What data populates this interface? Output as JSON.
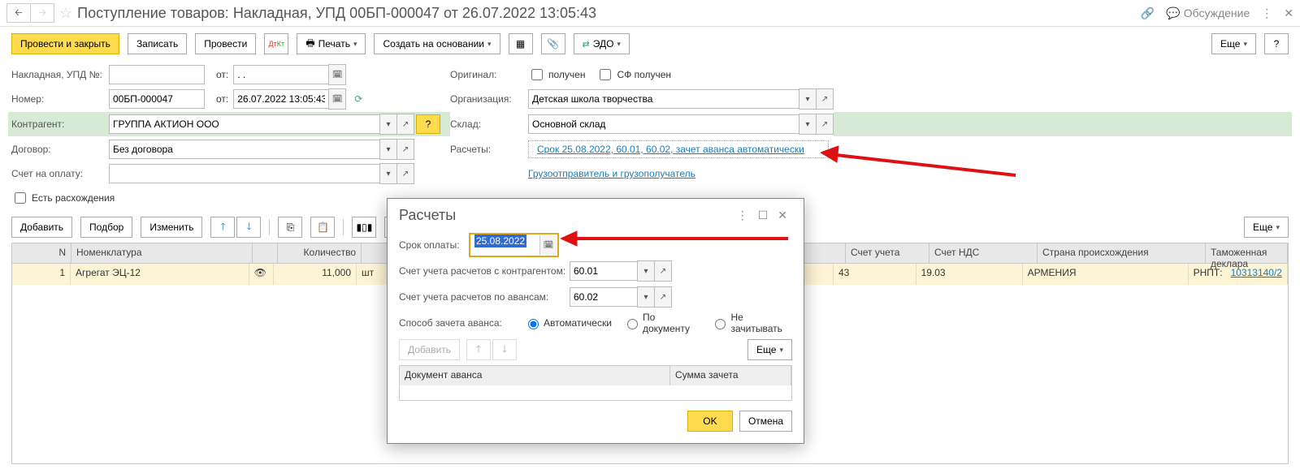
{
  "header": {
    "title": "Поступление товаров: Накладная, УПД 00БП-000047 от 26.07.2022 13:05:43",
    "discuss": "Обсуждение"
  },
  "cmd": {
    "post_close": "Провести и закрыть",
    "write": "Записать",
    "post": "Провести",
    "print": "Печать",
    "create_based": "Создать на основании",
    "edo": "ЭДО",
    "more": "Еще"
  },
  "form": {
    "invoice_label": "Накладная, УПД №:",
    "from": "от:",
    "date1": ". .",
    "number_label": "Номер:",
    "number": "00БП-000047",
    "date2": "26.07.2022 13:05:43",
    "contragent_label": "Контрагент:",
    "contragent": "ГРУППА АКТИОН ООО",
    "contract_label": "Договор:",
    "contract": "Без договора",
    "bill_label": "Счет на оплату:",
    "diff": "Есть расхождения",
    "original_label": "Оригинал:",
    "received": "получен",
    "sf_received": "СФ получен",
    "org_label": "Организация:",
    "org": "Детская школа творчества",
    "warehouse_label": "Склад:",
    "warehouse": "Основной склад",
    "settle_label": "Расчеты:",
    "settle_link": "Срок 25.08.2022, 60.01, 60.02, зачет аванса автоматически",
    "consignor": "Грузоотправитель и грузополучатель"
  },
  "grid_toolbar": {
    "add": "Добавить",
    "pick": "Подбор",
    "edit": "Изменить",
    "more": "Еще"
  },
  "grid": {
    "cols": {
      "n": "N",
      "name": "Номенклатура",
      "qty": "Количество",
      "acct": "Счет учета",
      "vat": "Счет НДС",
      "country": "Страна происхождения",
      "decl": "Таможенная деклара"
    },
    "row": {
      "n": "1",
      "name": "Агрегат ЭЦ-12",
      "qty": "11,000",
      "unit": "шт",
      "acct": "43",
      "vat": "19.03",
      "country": "АРМЕНИЯ",
      "decl_label": "РНПТ:",
      "decl_value": "10313140/2"
    }
  },
  "popup": {
    "title": "Расчеты",
    "term_label": "Срок оплаты:",
    "term_value": "25.08.2022",
    "acct_label": "Счет учета расчетов с контрагентом:",
    "acct_value": "60.01",
    "adv_label": "Счет учета расчетов по авансам:",
    "adv_value": "60.02",
    "mode_label": "Способ зачета аванса:",
    "mode_auto": "Автоматически",
    "mode_doc": "По документу",
    "mode_none": "Не зачитывать",
    "add": "Добавить",
    "more": "Еще",
    "col_doc": "Документ аванса",
    "col_sum": "Сумма зачета",
    "ok": "OK",
    "cancel": "Отмена"
  }
}
